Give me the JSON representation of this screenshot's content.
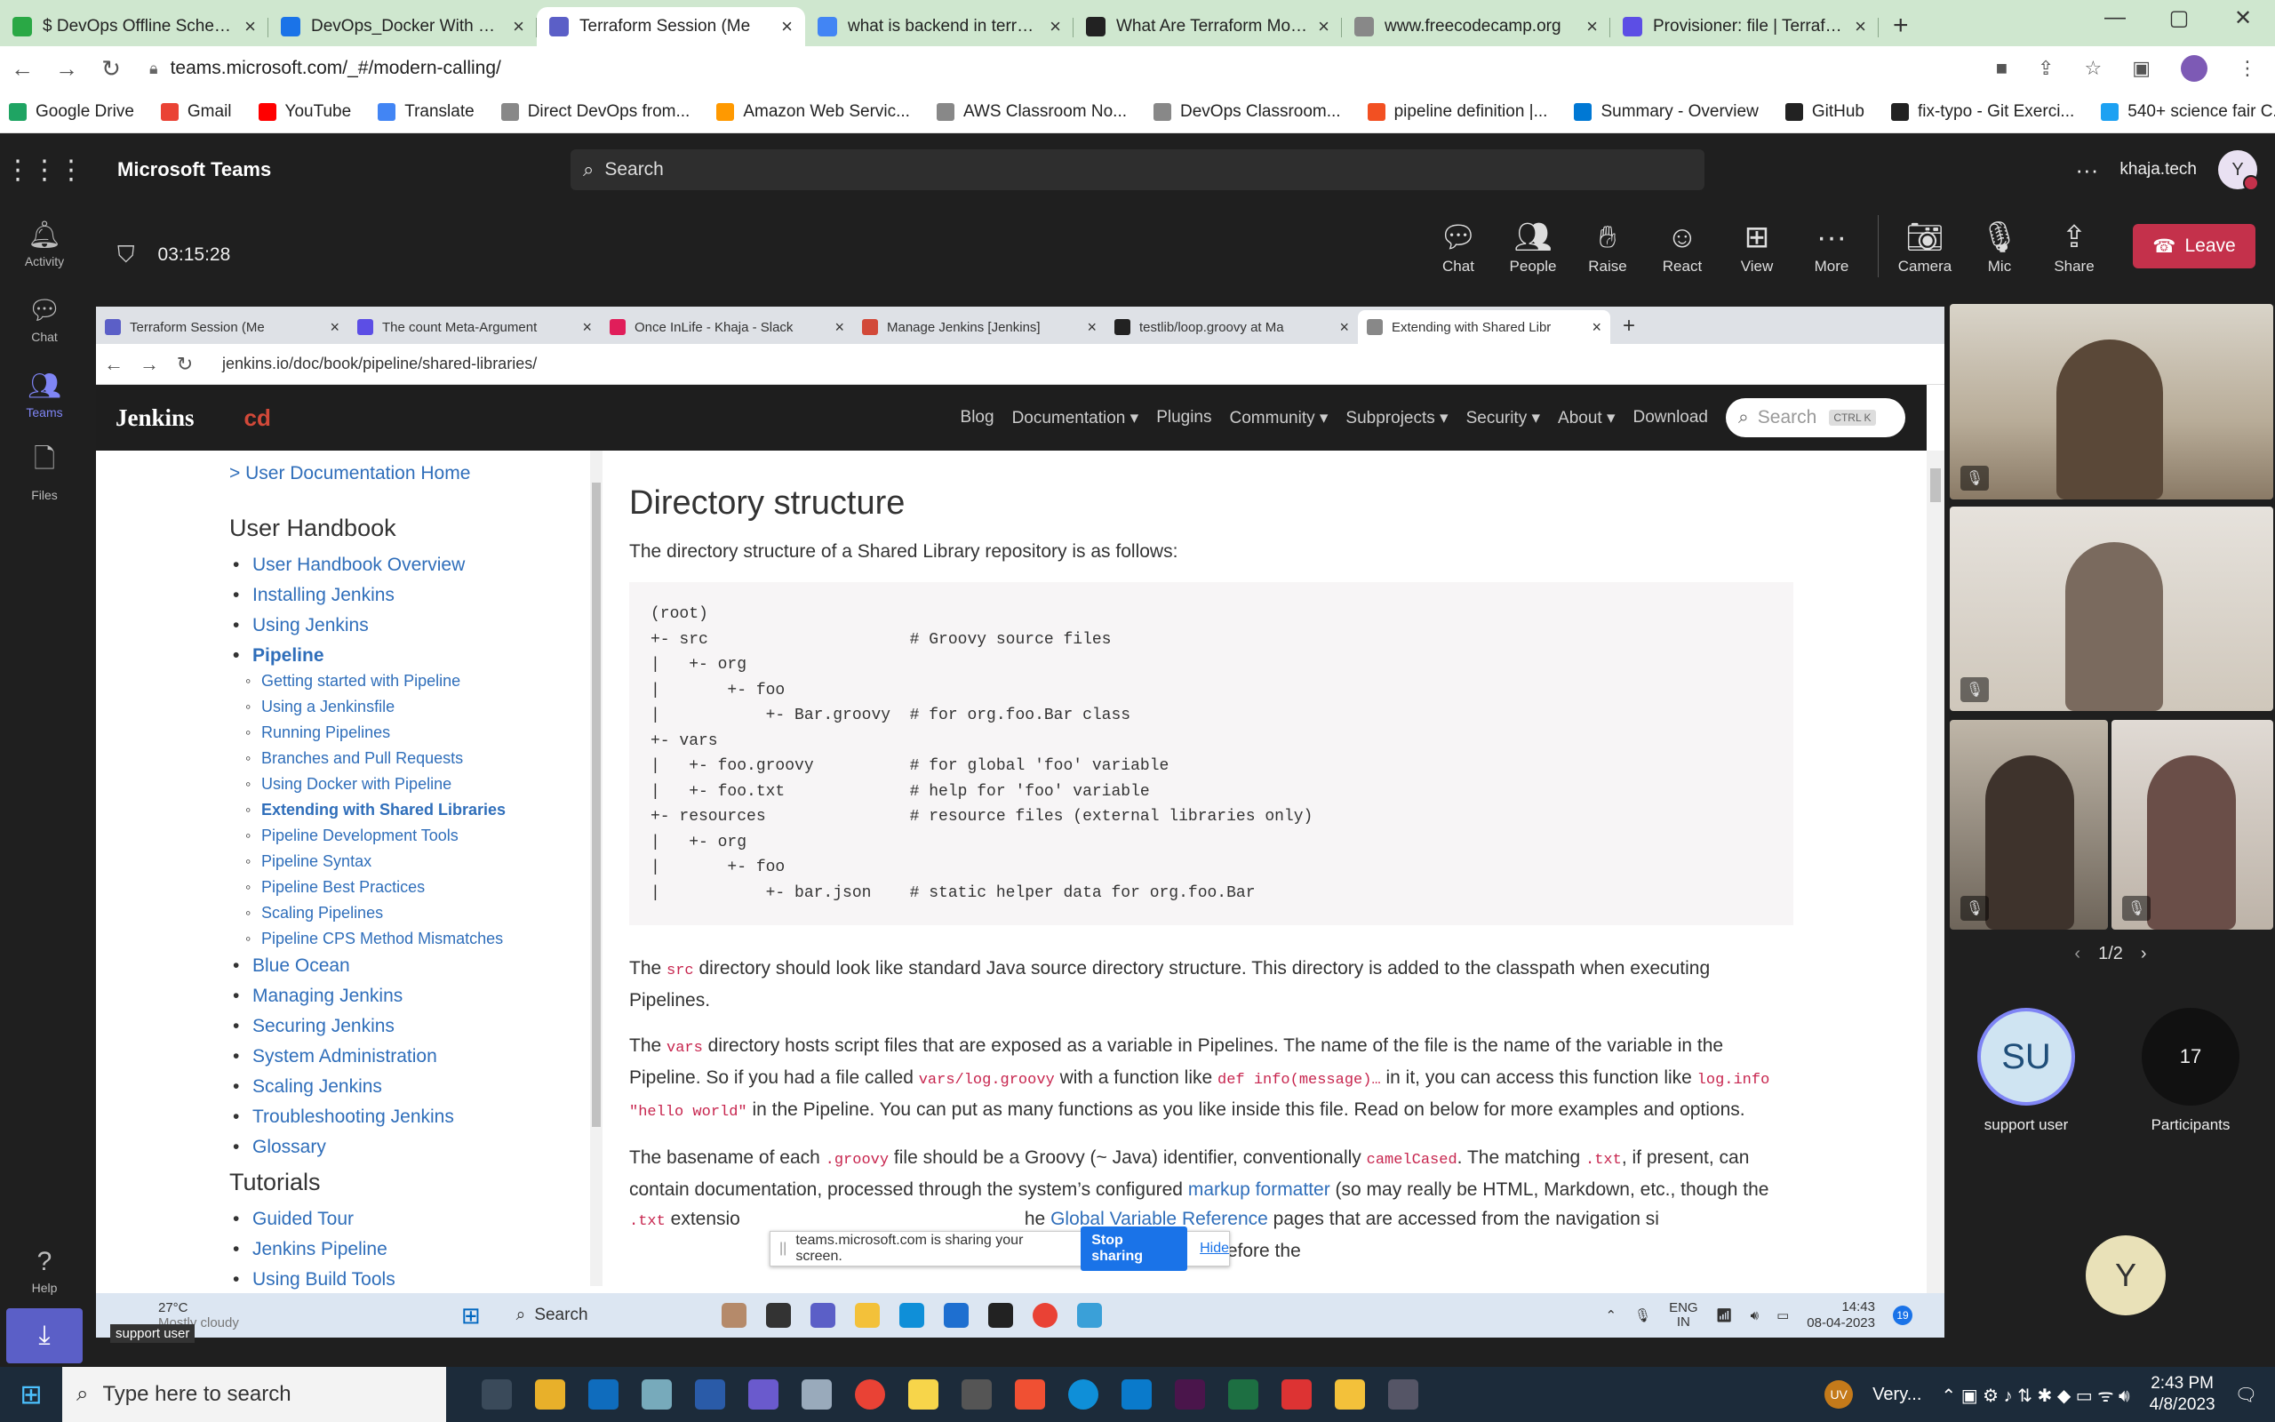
{
  "browser": {
    "tabs": [
      {
        "title": "$ DevOps Offline Schedule",
        "color": "#2aa845",
        "icon": "dollar-icon"
      },
      {
        "title": "DevOps_Docker With K8s",
        "color": "#1a73e8",
        "icon": "drive-icon"
      },
      {
        "title": "Terraform Session (Me",
        "color": "#5b5fc7",
        "icon": "teams-icon",
        "active": true
      },
      {
        "title": "what is backend in terraform",
        "color": "#4285f4",
        "icon": "google-icon"
      },
      {
        "title": "What Are Terraform Modules",
        "color": "#222",
        "icon": "medium-icon"
      },
      {
        "title": "www.freecodecamp.org",
        "color": "#888",
        "icon": "globe-icon"
      },
      {
        "title": "Provisioner: file | Terraform",
        "color": "#5c4ee5",
        "icon": "terraform-icon"
      }
    ],
    "url": "teams.microsoft.com/_#/modern-calling/",
    "bookmarks": [
      {
        "label": "Google Drive",
        "color": "#1fa463"
      },
      {
        "label": "Gmail",
        "color": "#ea4335"
      },
      {
        "label": "YouTube",
        "color": "#ff0000"
      },
      {
        "label": "Translate",
        "color": "#4285f4"
      },
      {
        "label": "Direct DevOps from...",
        "color": "#888"
      },
      {
        "label": "Amazon Web Servic...",
        "color": "#ff9900"
      },
      {
        "label": "AWS Classroom No...",
        "color": "#888"
      },
      {
        "label": "DevOps Classroom...",
        "color": "#888"
      },
      {
        "label": "pipeline definition |...",
        "color": "#f25022"
      },
      {
        "label": "Summary - Overview",
        "color": "#0078d4"
      },
      {
        "label": "GitHub",
        "color": "#222"
      },
      {
        "label": "fix-typo - Git Exerci...",
        "color": "#222"
      },
      {
        "label": "540+ science fair C...",
        "color": "#1da1f2"
      }
    ]
  },
  "teams": {
    "title": "Microsoft Teams",
    "search_placeholder": "Search",
    "org": "khaja.tech",
    "user_initial": "Y",
    "rail": [
      "Activity",
      "Chat",
      "Teams",
      "Files"
    ],
    "help": "Help",
    "timer": "03:15:28",
    "controls": [
      "Chat",
      "People",
      "Raise",
      "React",
      "View",
      "More",
      "Camera",
      "Mic",
      "Share"
    ],
    "leave": "Leave",
    "pager": "1/2",
    "support_user": {
      "initials": "SU",
      "label": "support user"
    },
    "participants": {
      "count": "17",
      "label": "Participants"
    },
    "self_initial": "Y"
  },
  "shared": {
    "tabs": [
      {
        "title": "Terraform Session (Me",
        "color": "#5b5fc7"
      },
      {
        "title": "The count Meta-Argument",
        "color": "#5c4ee5"
      },
      {
        "title": "Once InLife - Khaja - Slack",
        "color": "#e01e5a"
      },
      {
        "title": "Manage Jenkins [Jenkins]",
        "color": "#d24939"
      },
      {
        "title": "testlib/loop.groovy at Ma",
        "color": "#222"
      },
      {
        "title": "Extending with Shared Libr",
        "color": "#888",
        "active": true
      }
    ],
    "url": "jenkins.io/doc/book/pipeline/shared-libraries/",
    "jenkins": "Jenkins",
    "cd": "cd",
    "nav": [
      "Blog",
      "Documentation ▾",
      "Plugins",
      "Community ▾",
      "Subprojects ▾",
      "Security ▾",
      "About ▾",
      "Download"
    ],
    "search": "Search",
    "kbd": "CTRL K",
    "sidebar": {
      "home": "> User Documentation Home",
      "handbook_title": "User Handbook",
      "handbook": [
        "User Handbook Overview",
        "Installing Jenkins",
        "Using Jenkins",
        "Pipeline"
      ],
      "pipeline_sub": [
        "Getting started with Pipeline",
        "Using a Jenkinsfile",
        "Running Pipelines",
        "Branches and Pull Requests",
        "Using Docker with Pipeline",
        "Extending with Shared Libraries",
        "Pipeline Development Tools",
        "Pipeline Syntax",
        "Pipeline Best Practices",
        "Scaling Pipelines",
        "Pipeline CPS Method Mismatches"
      ],
      "handbook_more": [
        "Blue Ocean",
        "Managing Jenkins",
        "Securing Jenkins",
        "System Administration",
        "Scaling Jenkins",
        "Troubleshooting Jenkins",
        "Glossary"
      ],
      "tutorials_title": "Tutorials",
      "tutorials": [
        "Guided Tour",
        "Jenkins Pipeline",
        "Using Build Tools"
      ]
    },
    "heading": "Directory structure",
    "intro": "The directory structure of a Shared Library repository is as follows:",
    "code": "(root)\n+- src                     # Groovy source files\n|   +- org\n|       +- foo\n|           +- Bar.groovy  # for org.foo.Bar class\n+- vars\n|   +- foo.groovy          # for global 'foo' variable\n|   +- foo.txt             # help for 'foo' variable\n+- resources               # resource files (external libraries only)\n|   +- org\n|       +- foo\n|           +- bar.json    # static helper data for org.foo.Bar",
    "p1a": "The ",
    "p1code": "src",
    "p1b": " directory should look like standard Java source directory structure. This directory is added to the classpath when executing Pipelines.",
    "p2a": "The ",
    "p2code": "vars",
    "p2b": " directory hosts script files that are exposed as a variable in Pipelines. The name of the file is the name of the variable in the Pipeline. So if you had a file called ",
    "p2code2": "vars/log.groovy",
    "p2c": " with a function like ",
    "p2code3": "def info(message)…",
    "p2d": " in it, you can access this function like ",
    "p2code4": "log.info \"hello world\"",
    "p2e": " in the Pipeline. You can put as many functions as you like inside this file. Read on below for more examples and options.",
    "p3a": "The basename of each ",
    "p3code": ".groovy",
    "p3b": " file should be a Groovy (~ Java) identifier, conventionally ",
    "p3code2": "camelCased",
    "p3c": ". The matching ",
    "p3code3": ".txt",
    "p3d": ", if present, can contain documentation, processed through the system’s configured ",
    "p3link": "markup formatter",
    "p3e": " (so may really be HTML, Markdown, etc., though the ",
    "p3code4": ".txt",
    "p3f": " extensio",
    "p3g": "he ",
    "p3link2": "Global Variable Reference",
    "p3h": " pages that are accessed from the navigation si",
    "p3i": ", those jobs must run successfully once before the",
    "sharing": {
      "text": "teams.microsoft.com is sharing your screen.",
      "stop": "Stop sharing",
      "hide": "Hide"
    },
    "weather": {
      "temp": "27°C",
      "desc": "Mostly cloudy"
    },
    "support_tag": "support user",
    "tb_search": "Search",
    "tray": {
      "lang": "ENG",
      "region": "IN",
      "time": "14:43",
      "date": "08-04-2023",
      "badge": "19"
    }
  },
  "windows": {
    "search": "Type here to search",
    "user_badge": "UV",
    "weather": "Very...",
    "time": "2:43 PM",
    "date": "4/8/2023"
  }
}
